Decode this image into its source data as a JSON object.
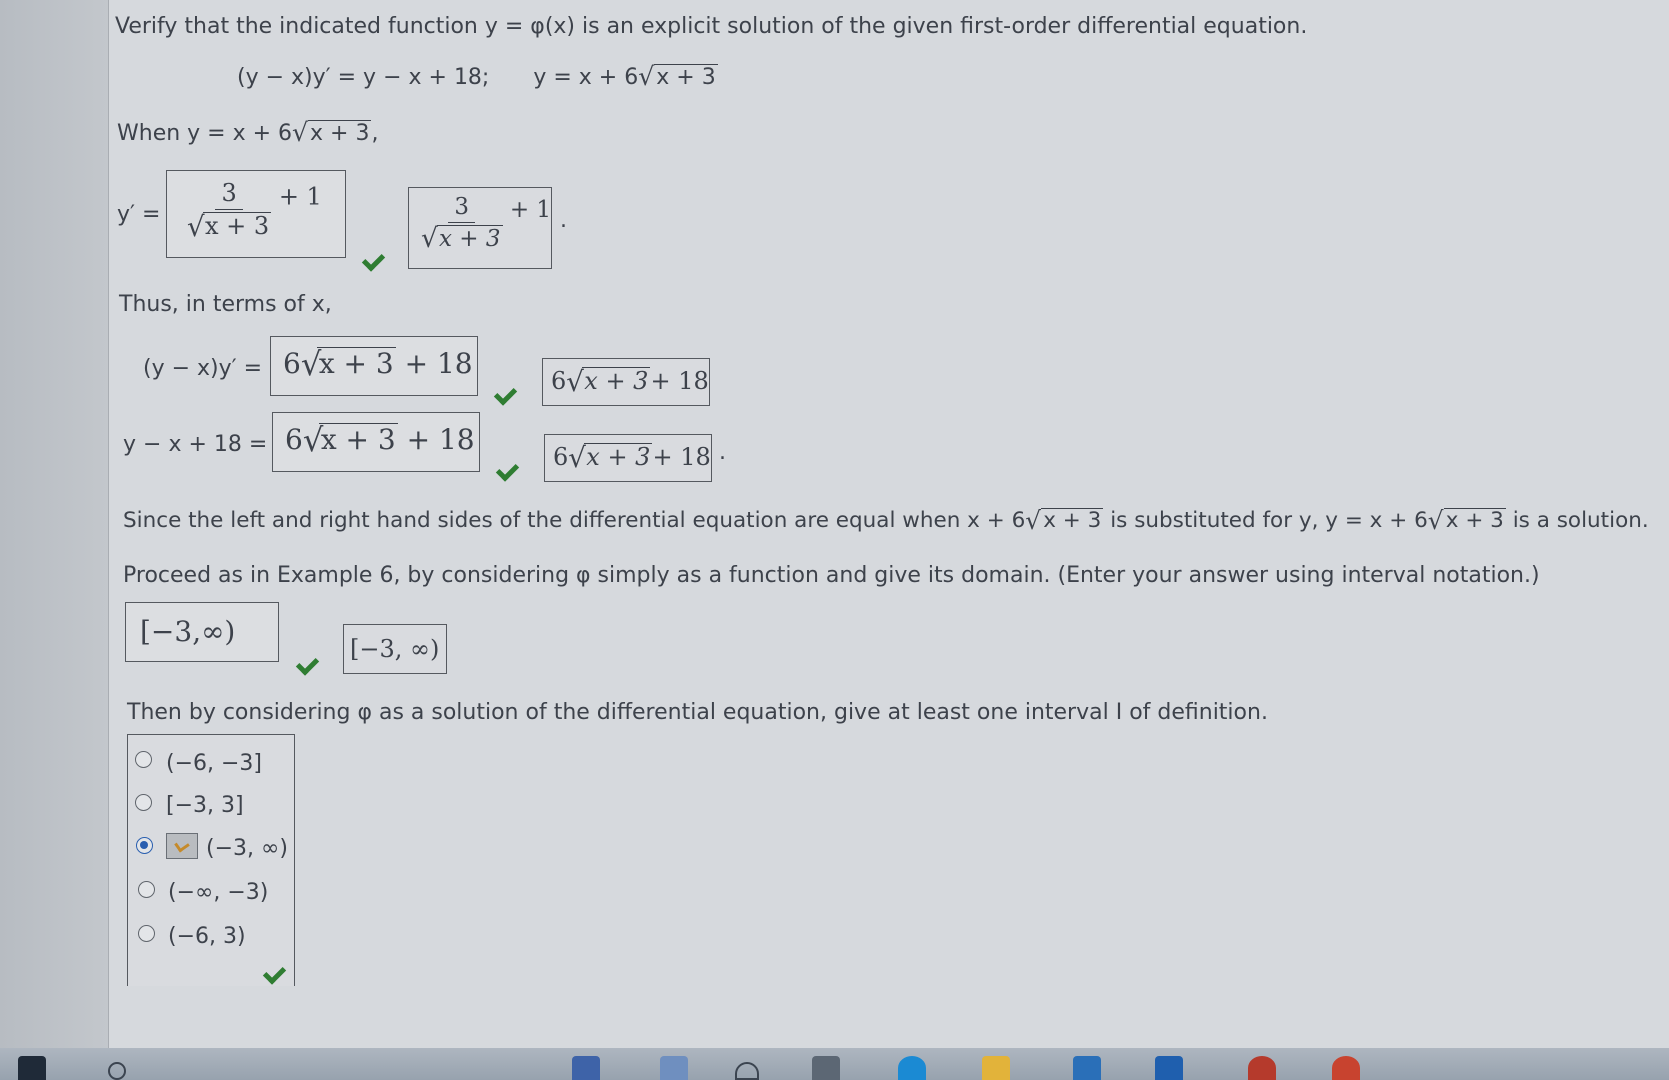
{
  "question": {
    "prompt": "Verify that the indicated function y = φ(x) is an explicit solution of the given first-order differential equation.",
    "equation": "(y − x)y′ = y − x + 18;",
    "function": "y = x + 6",
    "function_radicand": "x + 3"
  },
  "when_line": {
    "prefix": "When y = x + 6",
    "radicand": "x + 3",
    "suffix": ","
  },
  "derivative": {
    "label": "y′ =",
    "input": {
      "numerator": "3",
      "radicand": "x + 3",
      "tail": "+ 1"
    },
    "answer": {
      "numerator": "3",
      "radicand": "x + 3",
      "tail": "+ 1",
      "period": "."
    }
  },
  "thus_line": "Thus, in terms of x,",
  "lhs_row": {
    "label": "(y − x)y′ =",
    "input": {
      "coef": "6",
      "radicand": "x + 3",
      "tail": "+ 18"
    },
    "answer": {
      "coef": "6",
      "radicand": "x + 3",
      "tail": "+ 18"
    }
  },
  "rhs_row": {
    "label": "y − x + 18 =",
    "input": {
      "coef": "6",
      "radicand": "x + 3",
      "tail": "+ 18"
    },
    "answer": {
      "coef": "6",
      "radicand": "x + 3",
      "tail": "+ 18"
    },
    "period": "."
  },
  "since_line": {
    "part1": "Since the left and right hand sides of the differential equation are equal when x + 6",
    "radicand1": "x + 3",
    "part2": "is substituted for y, y = x + 6",
    "radicand2": "x + 3",
    "part3": "is a solution."
  },
  "domain_question": "Proceed as in Example 6, by considering φ simply as a function and give its domain. (Enter your answer using interval notation.)",
  "domain_input": "[−3,∞)",
  "domain_answer": "[−3, ∞)",
  "interval_question": "Then by considering φ as a solution of the differential equation, give at least one interval I of definition.",
  "options": [
    {
      "label": "(−6, −3]",
      "selected": false
    },
    {
      "label": "[−3, 3]",
      "selected": false
    },
    {
      "label": "(−3, ∞)",
      "selected": true
    },
    {
      "label": "(−∞, −3)",
      "selected": false
    },
    {
      "label": "(−6, 3)",
      "selected": false
    }
  ],
  "colors": {
    "check": "#2f7d32",
    "radio_selected": "#2a5fb0",
    "panel": "#d6d9dd"
  }
}
